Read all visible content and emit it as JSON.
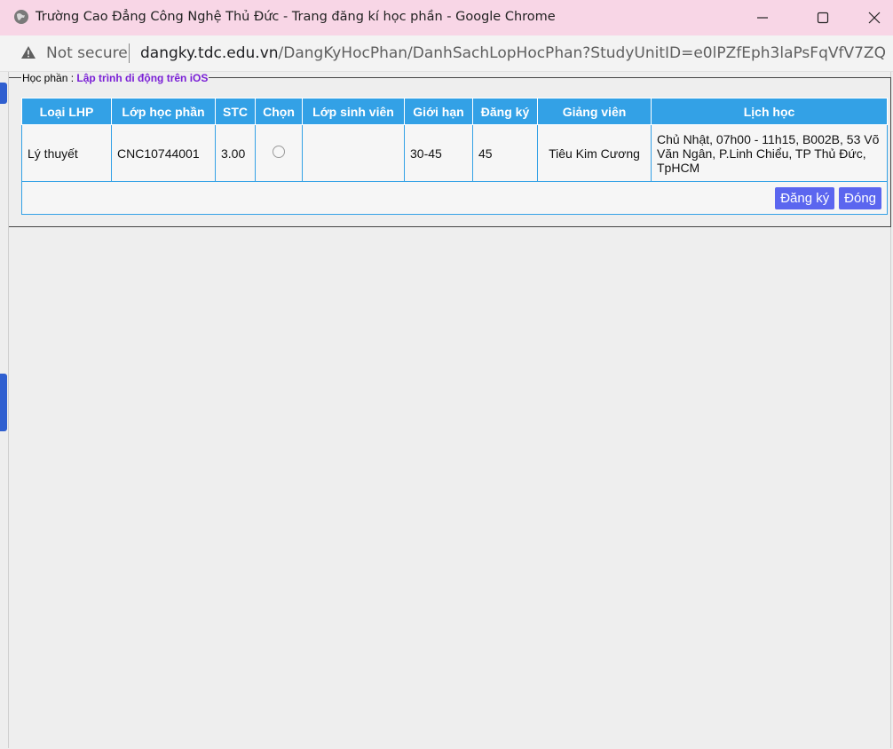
{
  "window": {
    "title": "Trường Cao Đẳng Công Nghệ Thủ Đức - Trang đăng kí học phần - Google Chrome",
    "title_bar_color": "#f8d6e6"
  },
  "address_bar": {
    "security_label": "Not secure",
    "url_host": "dangky.tdc.edu.vn",
    "url_path": "/DangKyHocPhan/DanhSachLopHocPhan?StudyUnitID=e0lPZfEph3laPsFqVfV7ZQ==&C..."
  },
  "course": {
    "label": "Học phần :",
    "name": "Lập trình di động trên iOS",
    "name_color": "#7a1fd6"
  },
  "table": {
    "header_color": "#33a1e6",
    "columns": [
      "Loại LHP",
      "Lớp học phần",
      "STC",
      "Chọn",
      "Lớp sinh viên",
      "Giới hạn",
      "Đăng ký",
      "Giảng viên",
      "Lịch học"
    ],
    "rows": [
      {
        "type": "Lý thuyết",
        "class_code": "CNC10744001",
        "credits": "3.00",
        "student_class": "",
        "limit": "30-45",
        "registered": "45",
        "lecturer": "Tiêu Kim Cương",
        "schedule": "Chủ Nhật, 07h00 - 11h15, B002B, 53 Võ Văn Ngân, P.Linh Chiểu, TP Thủ Đức, TpHCM"
      }
    ]
  },
  "buttons": {
    "register": "Đăng ký",
    "close": "Đóng",
    "color": "#5b66ef"
  }
}
